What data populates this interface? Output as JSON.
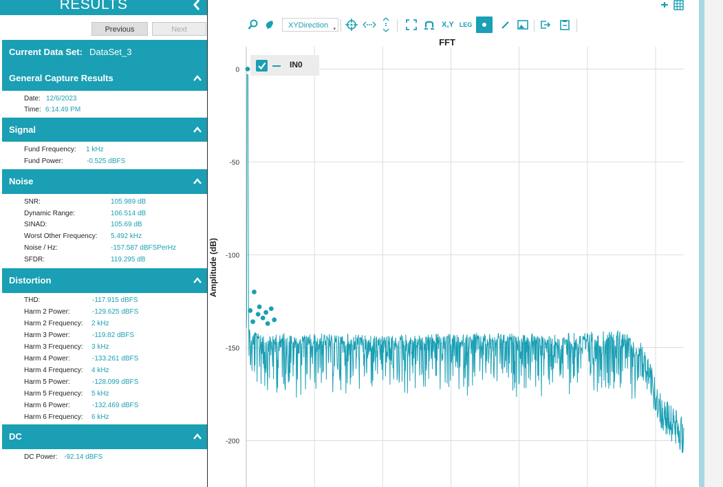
{
  "panel": {
    "title": "RESULTS",
    "collapse_icon": "chevron-left-icon",
    "previous_label": "Previous",
    "next_label": "Next",
    "current_data_set_label": "Current Data Set:",
    "current_data_set_value": "DataSet_3"
  },
  "sections": {
    "general": {
      "title": "General Capture Results",
      "rows": [
        {
          "label": "Date:",
          "value": "12/6/2023"
        },
        {
          "label": "Time:",
          "value": "6:14:49 PM"
        }
      ]
    },
    "signal": {
      "title": "Signal",
      "rows": [
        {
          "label": "Fund Frequency:",
          "value": "1 kHz"
        },
        {
          "label": "Fund Power:",
          "value": "-0.525 dBFS"
        }
      ]
    },
    "noise": {
      "title": "Noise",
      "rows": [
        {
          "label": "SNR:",
          "value": "105.989 dB"
        },
        {
          "label": "Dynamic Range:",
          "value": "106.514 dB"
        },
        {
          "label": "SINAD:",
          "value": "105.69 dB"
        },
        {
          "label": "Worst Other Frequency:",
          "value": "5.492 kHz"
        },
        {
          "label": "Noise / Hz:",
          "value": "-157.587 dBFSPerHz"
        },
        {
          "label": "SFDR:",
          "value": "119.295 dB"
        }
      ]
    },
    "distortion": {
      "title": "Distortion",
      "rows": [
        {
          "label": "THD:",
          "value": "-117.915 dBFS"
        },
        {
          "label": "Harm 2 Power:",
          "value": "-129.625 dBFS"
        },
        {
          "label": "Harm 2 Frequency:",
          "value": "2 kHz"
        },
        {
          "label": "Harm 3 Power:",
          "value": "-119.82 dBFS"
        },
        {
          "label": "Harm 3 Frequency:",
          "value": "3 kHz"
        },
        {
          "label": "Harm 4 Power:",
          "value": "-133.261 dBFS"
        },
        {
          "label": "Harm 4 Frequency:",
          "value": "4 kHz"
        },
        {
          "label": "Harm 5 Power:",
          "value": "-128.099 dBFS"
        },
        {
          "label": "Harm 5 Frequency:",
          "value": "5 kHz"
        },
        {
          "label": "Harm 6 Power:",
          "value": "-132.469 dBFS"
        },
        {
          "label": "Harm 6 Frequency:",
          "value": "6 kHz"
        }
      ]
    },
    "dc": {
      "title": "DC",
      "rows": [
        {
          "label": "DC Power:",
          "value": "-92.14 dBFS"
        }
      ]
    }
  },
  "toolbar": {
    "xy_direction": "XYDirection",
    "xy_label": "X,Y",
    "leg_label": "LEG",
    "icons": [
      "zoom-icon",
      "pan-hand-icon",
      "crosshair-icon",
      "horizontal-scale-icon",
      "vertical-scale-icon",
      "fit-to-screen-icon",
      "magnet-icon",
      "xy-label-icon",
      "legend-icon",
      "cursor-toggle-icon",
      "pen-icon",
      "image-icon",
      "export-icon",
      "clipboard-icon"
    ]
  },
  "colors": {
    "accent": "#1a9fb4",
    "series": "#1a9fb4",
    "sidebar_border": "#a6d7e3"
  },
  "chart_data": {
    "type": "line",
    "title": "FFT",
    "xlabel": "",
    "ylabel": "Amplitude (dB)",
    "ylim": [
      -225,
      12
    ],
    "y_ticks": [
      0,
      -50,
      -100,
      -150,
      -200
    ],
    "grid": true,
    "legend_placement": "top-left",
    "series": [
      {
        "name": "IN0",
        "x_norm": [
          0.0,
          0.003,
          0.006,
          0.009,
          0.012,
          0.02,
          0.05,
          0.15,
          0.3,
          0.45,
          0.6,
          0.75,
          0.85,
          0.88,
          0.91,
          0.95,
          1.0
        ],
        "values": [
          -143,
          -3,
          -143,
          -147,
          -150,
          -146,
          -148,
          -148,
          -149,
          -148,
          -148,
          -148,
          -146,
          -150,
          -160,
          -185,
          -198
        ],
        "noise_floor_range": [
          -175,
          -138
        ]
      }
    ],
    "markers": [
      {
        "x_norm": 0.003,
        "y": 0
      },
      {
        "x_norm": 0.018,
        "y": -120
      },
      {
        "x_norm": 0.009,
        "y": -130
      },
      {
        "x_norm": 0.027,
        "y": -132
      },
      {
        "x_norm": 0.03,
        "y": -128
      },
      {
        "x_norm": 0.045,
        "y": -131
      },
      {
        "x_norm": 0.057,
        "y": -129
      },
      {
        "x_norm": 0.015,
        "y": -136
      },
      {
        "x_norm": 0.049,
        "y": -137
      },
      {
        "x_norm": 0.064,
        "y": -135
      },
      {
        "x_norm": 0.038,
        "y": -134
      }
    ]
  }
}
